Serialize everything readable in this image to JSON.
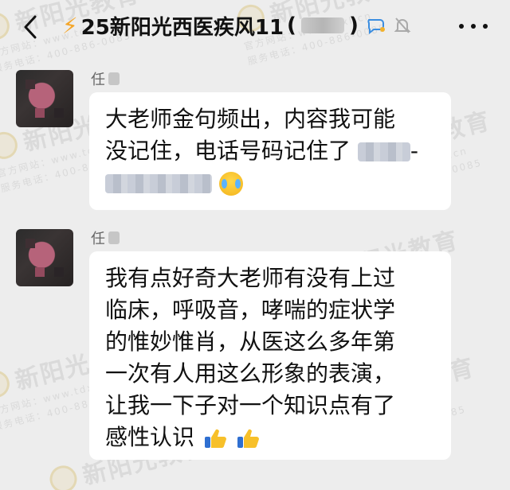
{
  "header": {
    "title": "25新阳光西医疾风11",
    "paren_open": "(",
    "paren_close": ")",
    "lightning_icon": "lightning-icon",
    "back_icon": "chevron-left-icon",
    "more_icon": "more-dots-icon",
    "chat_icon": "chat-bubble-icon",
    "mute_icon": "bell-off-icon"
  },
  "watermark": {
    "brand": "新阳光教育",
    "line1": "官方网站：www.tdxl.cn",
    "line2": "服务电话：400-886-0085"
  },
  "messages": [
    {
      "sender": "任",
      "lines": [
        "大老师金句频出，内容我可能",
        "没记住，电话号码记住了",
        ""
      ],
      "suffix": "-"
    },
    {
      "sender": "任",
      "lines": [
        "我有点好奇大老师有没有上过",
        "临床，呼吸音，哮喘的症状学",
        "的惟妙惟肖，从医这么多年第",
        "一次有人用这么形象的表演，",
        "让我一下子对一个知识点有了",
        "感性认识"
      ]
    }
  ],
  "colors": {
    "background": "#ededed",
    "bubble": "#ffffff",
    "accent": "#f4a62a"
  }
}
